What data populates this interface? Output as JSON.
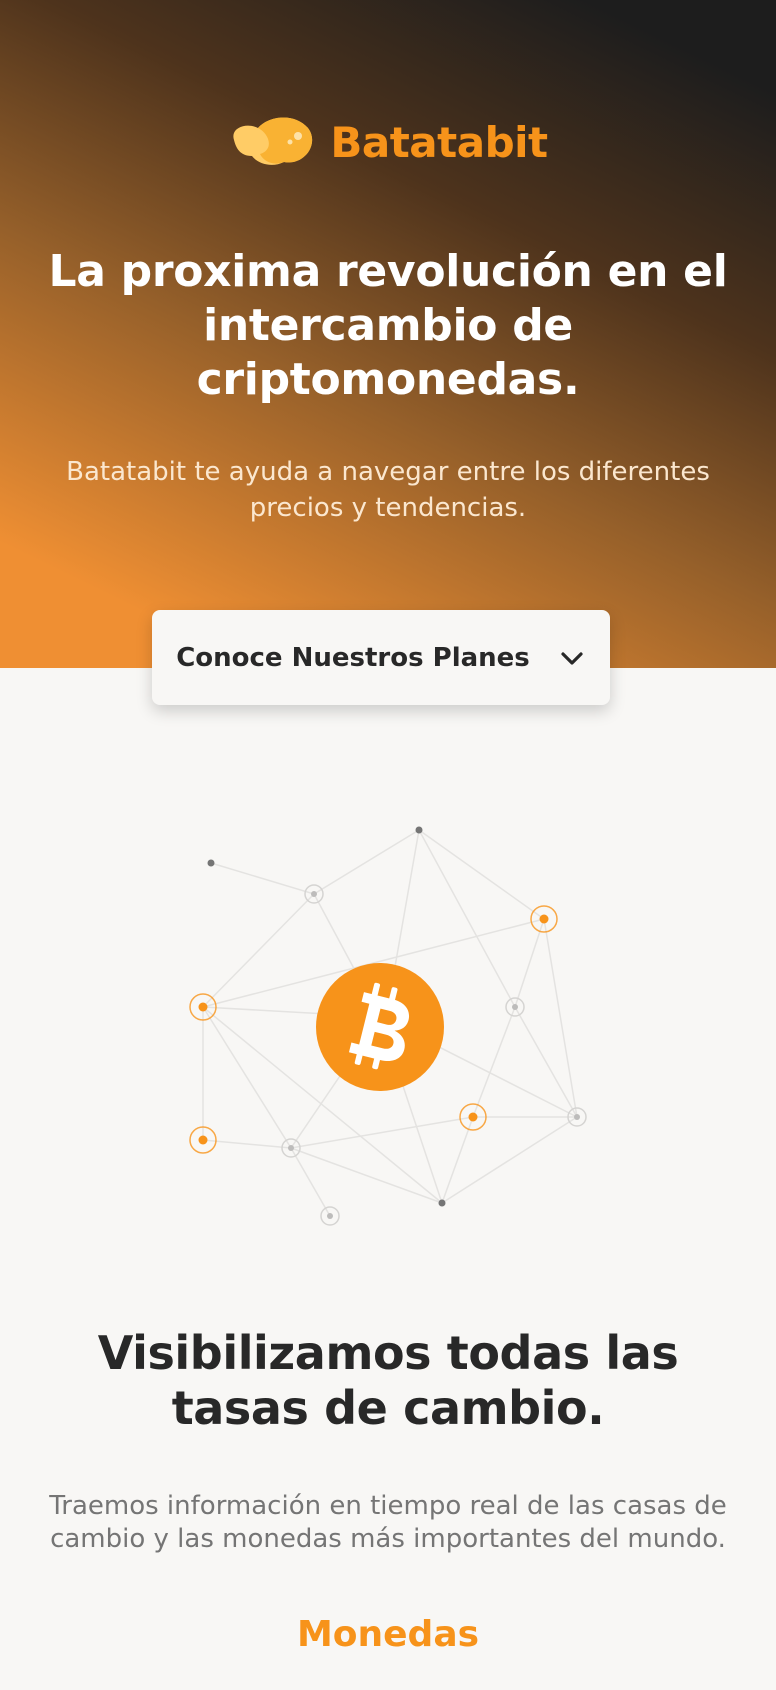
{
  "brand": {
    "name": "Batatabit",
    "color": "#f7931a"
  },
  "hero": {
    "title": "La proxima revolución en el intercambio de criptomonedas.",
    "subtitle": "Batatabit te ayuda a navegar entre los diferentes precios y tendencias.",
    "gradient_colors": [
      "#1d1d1d",
      "#4e331c",
      "#96602a",
      "#ef8f33"
    ]
  },
  "plans_button": {
    "label": "Conoce Nuestros Planes",
    "icon": "chevron-down-icon"
  },
  "illustration": {
    "icon": "bitcoin-icon",
    "accent": "#f7931a"
  },
  "section": {
    "title": "Visibilizamos todas las tasas de cambio.",
    "text": "Traemos información en tiempo real de las casas de cambio y las monedas más importantes del mundo.",
    "link_label": "Monedas"
  }
}
